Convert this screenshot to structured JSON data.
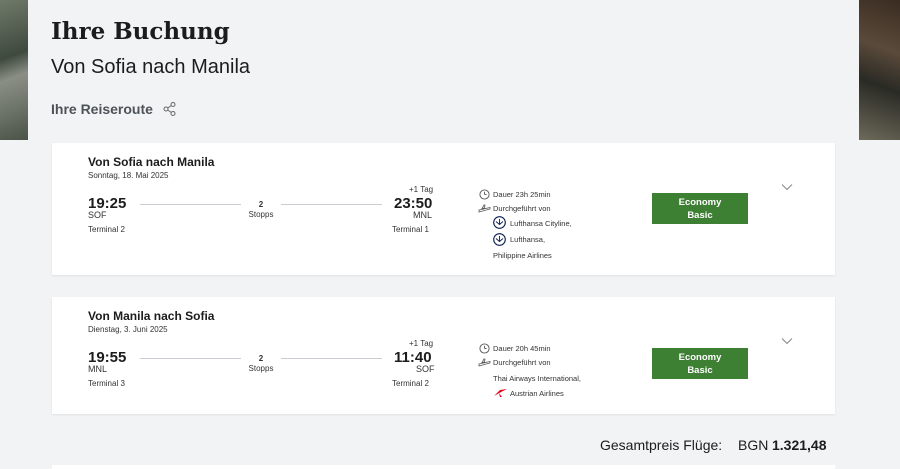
{
  "header": {
    "title": "Ihre Buchung",
    "subtitle": "Von Sofia nach Manila",
    "route_label": "Ihre Reiseroute"
  },
  "segments": [
    {
      "title": "Von Sofia nach Manila",
      "date": "Sonntag, 18. Mai 2025",
      "dep_time": "19:25",
      "dep_code": "SOF",
      "dep_terminal": "Terminal 2",
      "stops_count": "2",
      "stops_label": "Stopps",
      "plus_day": "+1 Tag",
      "arr_time": "23:50",
      "arr_code": "MNL",
      "arr_terminal": "Terminal 1",
      "duration": "Dauer 23h 25min",
      "operated_label": "Durchgeführt von",
      "carriers": [
        "Lufthansa Cityline,",
        "Lufthansa,",
        "Philippine Airlines"
      ],
      "fare_line1": "Economy",
      "fare_line2": "Basic"
    },
    {
      "title": "Von Manila nach Sofia",
      "date": "Dienstag, 3. Juni 2025",
      "dep_time": "19:55",
      "dep_code": "MNL",
      "dep_terminal": "Terminal 3",
      "stops_count": "2",
      "stops_label": "Stopps",
      "plus_day": "+1 Tag",
      "arr_time": "11:40",
      "arr_code": "SOF",
      "arr_terminal": "Terminal 2",
      "duration": "Dauer 20h 45min",
      "operated_label": "Durchgeführt von",
      "carriers": [
        "Thai Airways International,",
        "Austrian Airlines"
      ],
      "fare_line1": "Economy",
      "fare_line2": "Basic"
    }
  ],
  "total": {
    "label": "Gesamtpreis Flüge:",
    "currency": "BGN",
    "amount": "1.321,48"
  },
  "colors": {
    "fare_button": "#3d7f33",
    "page_bg": "#f1f3f4",
    "lufthansa_blue": "#0a1d4d",
    "austrian_red": "#e2001a"
  },
  "icons": [
    "share-icon",
    "clock-icon",
    "plane-icon",
    "lufthansa-logo-icon",
    "austrian-logo-icon",
    "chevron-down-icon"
  ]
}
